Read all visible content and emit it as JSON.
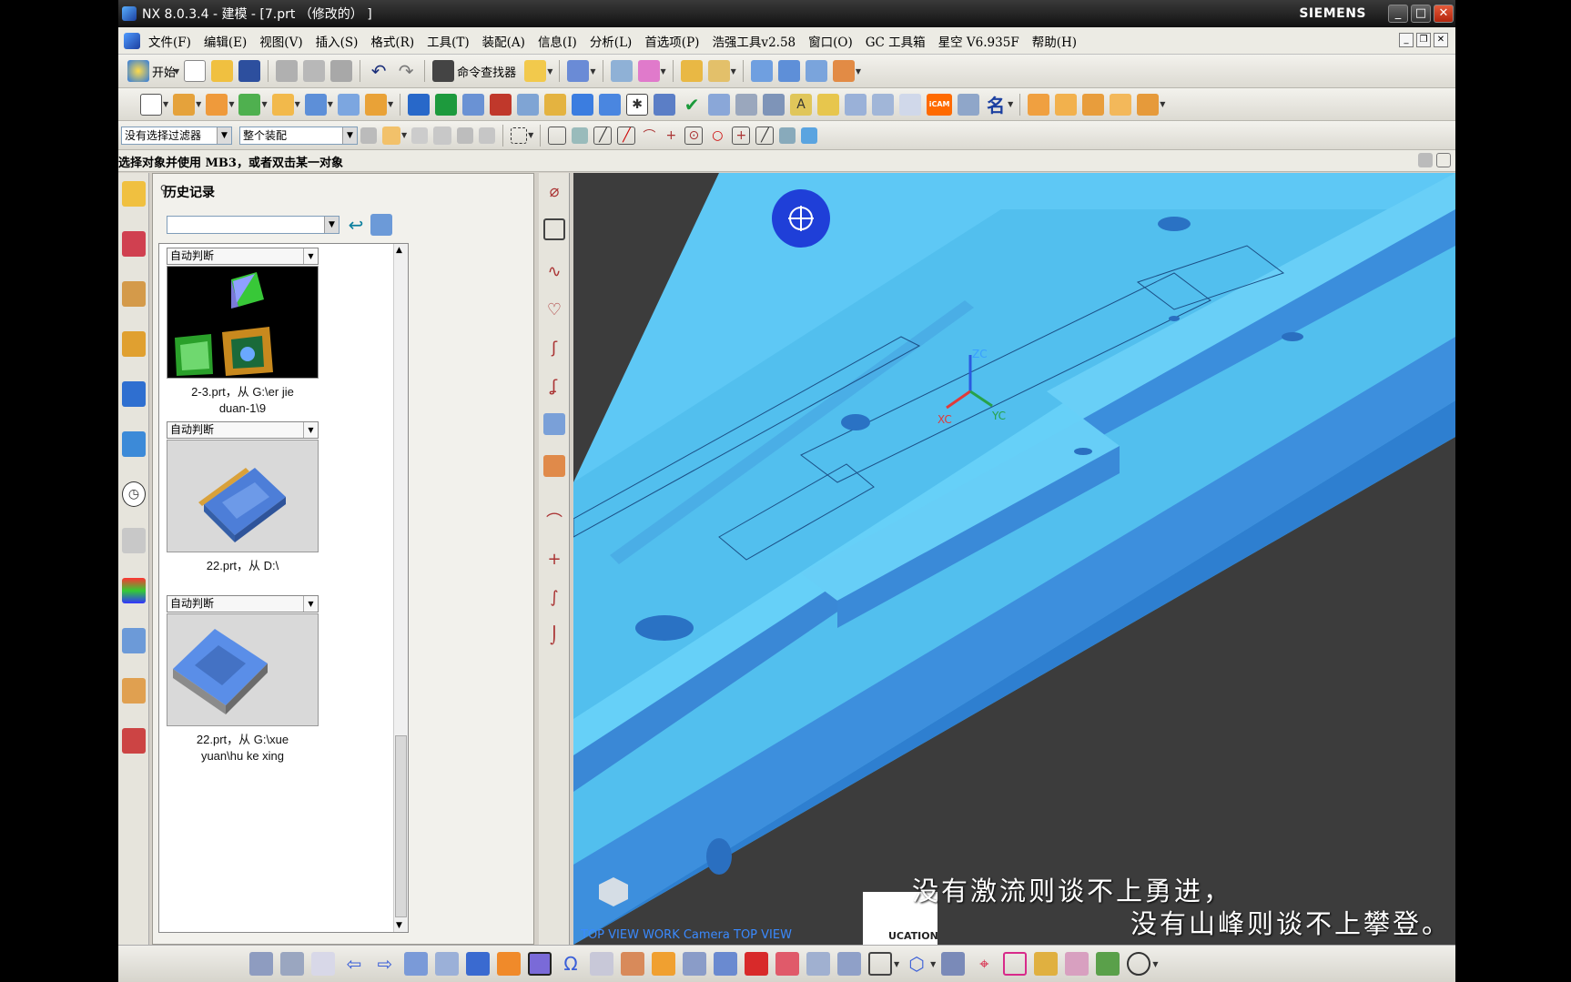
{
  "titlebar": {
    "title": "NX 8.0.3.4 - 建模 - [7.prt （修改的） ]",
    "brand": "SIEMENS"
  },
  "menu": {
    "items": [
      "文件(F)",
      "编辑(E)",
      "视图(V)",
      "插入(S)",
      "格式(R)",
      "工具(T)",
      "装配(A)",
      "信息(I)",
      "分析(L)",
      "首选项(P)",
      "浩强工具v2.58",
      "窗口(O)",
      "GC 工具箱",
      "星空 V6.935F",
      "帮助(H)"
    ]
  },
  "toolbar1": {
    "start_label": "开始",
    "command_finder_label": "命令查找器"
  },
  "toolbar2": {
    "name_label": "名",
    "icam_label": "iCAM"
  },
  "selectionbar": {
    "filter_value": "没有选择过滤器",
    "scope_value": "整个装配"
  },
  "status": {
    "message": "选择对象并使用 MB3，或者双击某一对象"
  },
  "history": {
    "title": "历史记录",
    "combo_value": "",
    "cards": [
      {
        "filter": "自动判断",
        "caption1": "2-3.prt，从 G:\\er jie",
        "caption2": "duan-1\\9",
        "preview": "cubes"
      },
      {
        "filter": "自动判断",
        "caption1": "22.prt，从 D:\\",
        "caption2": "",
        "preview": "mold-orange"
      },
      {
        "filter": "自动判断",
        "caption1": "22.prt，从 G:\\xue",
        "caption2": "yuan\\hu ke xing",
        "preview": "mold-blue"
      }
    ]
  },
  "viewport": {
    "view_label": "TOP VIEW WORK Camera TOP VIEW",
    "watermark": "UCATION",
    "axes": {
      "z": "ZC",
      "x": "XC",
      "y": "YC"
    },
    "subtitle_line1": "没有激流则谈不上勇进，",
    "subtitle_line2": "没有山峰则谈不上攀登。"
  },
  "colors": {
    "model_light": "#5ec8f5",
    "model_dark": "#2e7fd0",
    "background": "#3c3c3c",
    "accent": "#ff6a00"
  }
}
